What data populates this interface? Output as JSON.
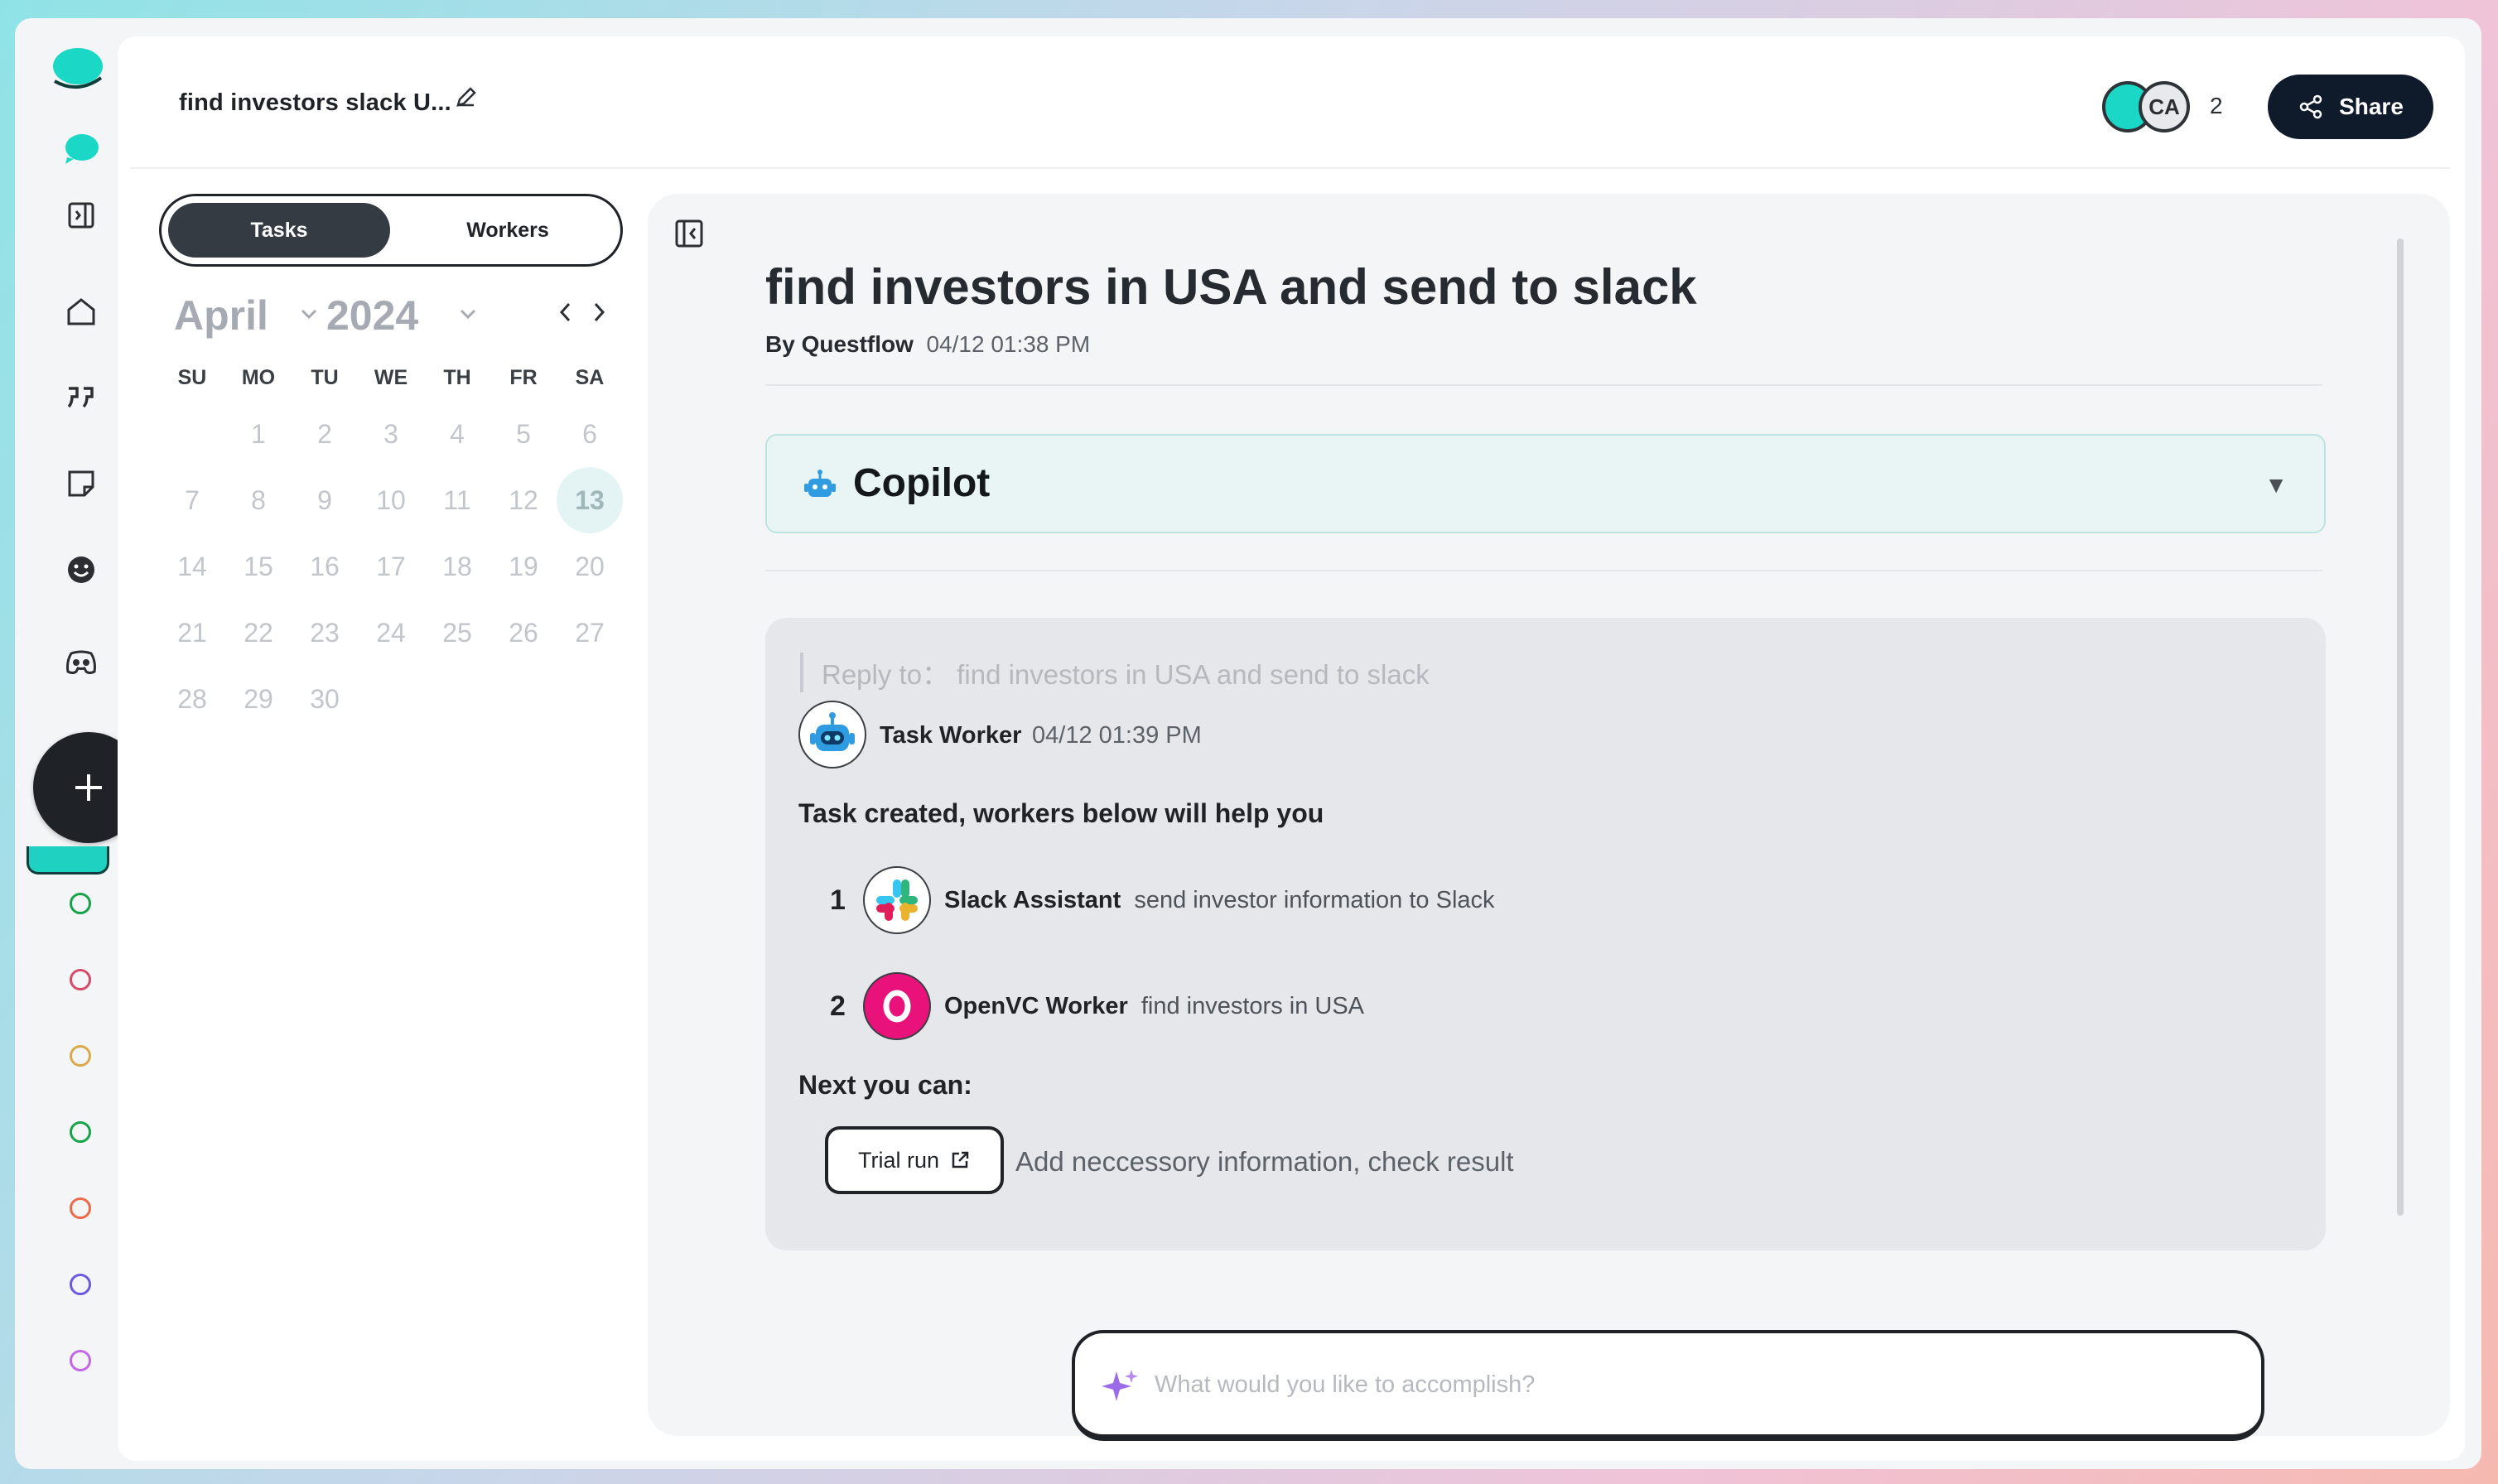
{
  "header": {
    "title": "find investors slack U...",
    "avatar_initials": "CA",
    "participant_count": "2",
    "share_label": "Share"
  },
  "sidebar_tabs": {
    "tasks": "Tasks",
    "workers": "Workers"
  },
  "calendar": {
    "month": "April",
    "year": "2024",
    "weekdays": [
      "SU",
      "MO",
      "TU",
      "WE",
      "TH",
      "FR",
      "SA"
    ],
    "days": [
      "",
      "1",
      "2",
      "3",
      "4",
      "5",
      "6",
      "7",
      "8",
      "9",
      "10",
      "11",
      "12",
      "13",
      "14",
      "15",
      "16",
      "17",
      "18",
      "19",
      "20",
      "21",
      "22",
      "23",
      "24",
      "25",
      "26",
      "27",
      "28",
      "29",
      "30"
    ],
    "today": "13"
  },
  "task": {
    "title": "find investors in USA and send to slack",
    "by_label": "By Questflow",
    "timestamp": "04/12 01:38 PM"
  },
  "copilot": {
    "label": "Copilot",
    "toggle": "▼"
  },
  "message": {
    "reply_to": "Reply to： find investors in USA and send to slack",
    "sender": "Task Worker",
    "time": "04/12 01:39 PM",
    "headline": "Task created, workers below will help you",
    "workers": [
      {
        "num": "1",
        "name": "Slack Assistant",
        "desc": "send investor information to Slack"
      },
      {
        "num": "2",
        "name": "OpenVC Worker",
        "desc": "find investors in USA"
      }
    ],
    "next_label": "Next you can:",
    "trial_label": "Trial run",
    "trial_desc": "Add neccessory information, check result"
  },
  "composer": {
    "placeholder": "What would you like to accomplish?"
  },
  "colors": {
    "brand_teal": "#1bd8c6",
    "share_bg": "#0f1a2b",
    "openvc_pink": "#e8127a"
  }
}
